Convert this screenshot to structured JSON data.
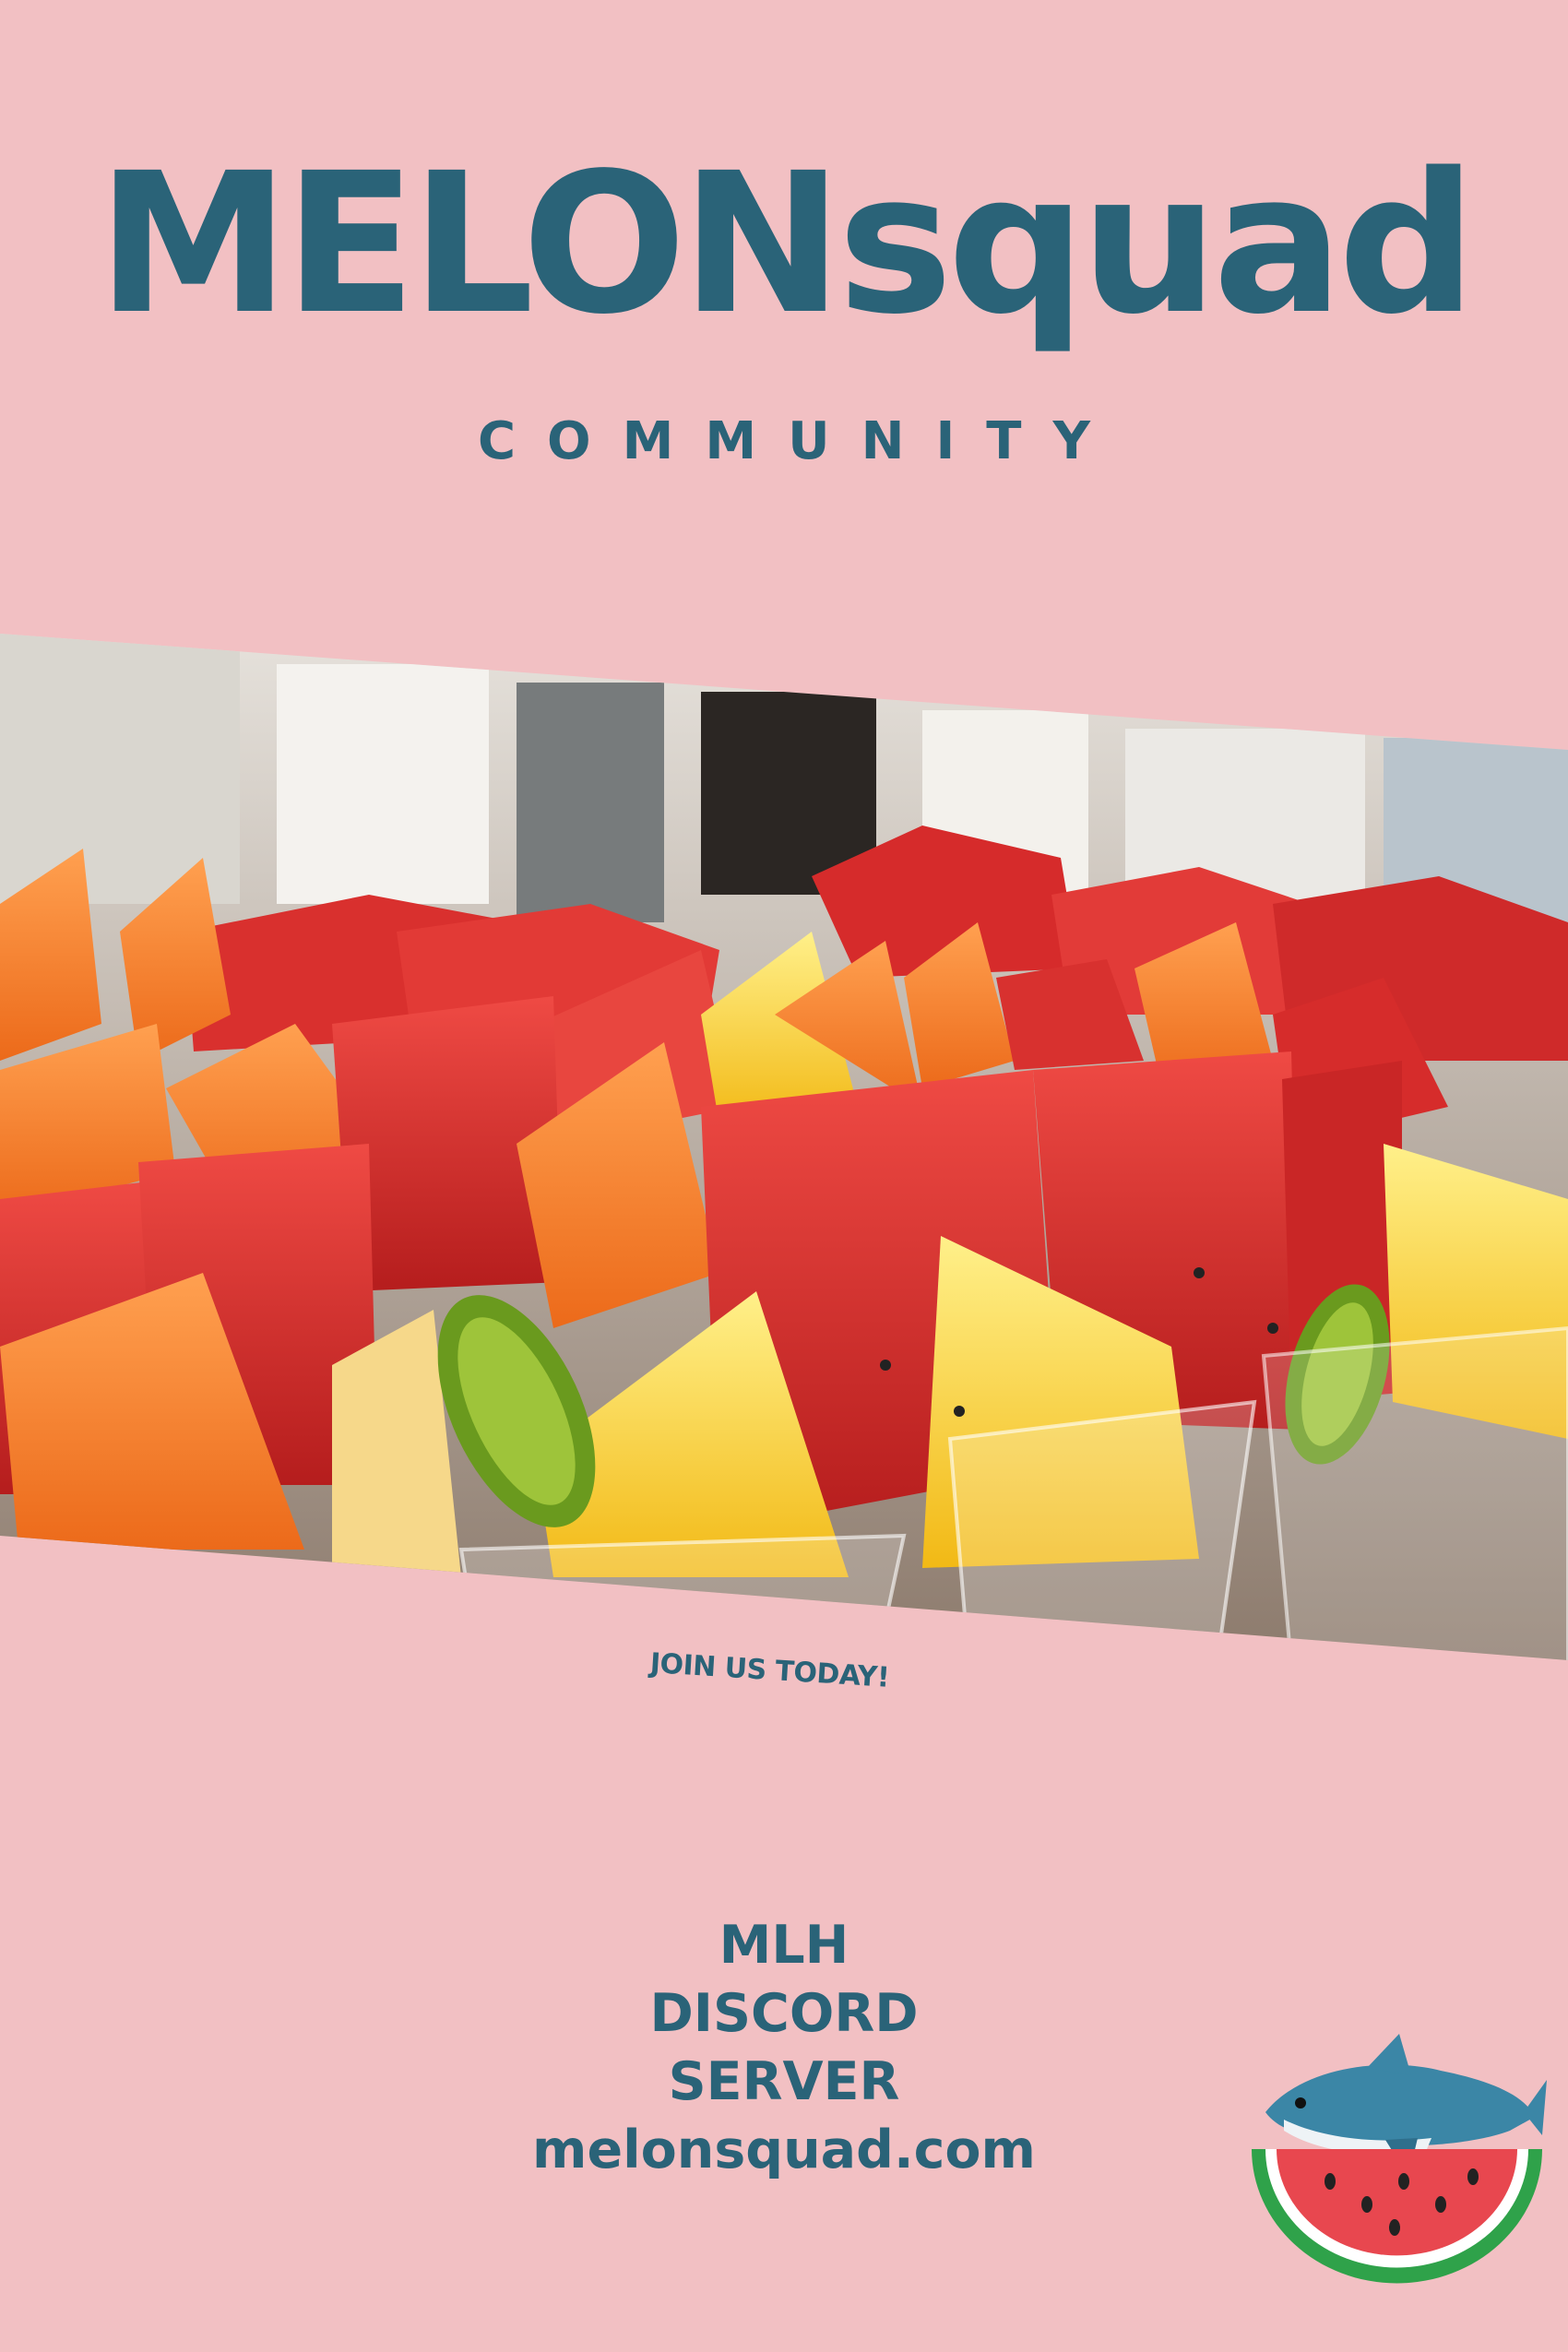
{
  "title": "MELONsquad",
  "subtitle": "COMMUNITY",
  "photo": {
    "subject": "cups of cut watermelon, cantaloupe, pineapple and kiwi"
  },
  "cta": "JOIN US TODAY!",
  "info": {
    "line1": "MLH",
    "line2": "DISCORD",
    "line3": "SERVER",
    "url": "melonsquad.com"
  },
  "mascot": {
    "icon": "shark-on-watermelon-icon"
  },
  "colors": {
    "background": "#f2c0c3",
    "text": "#2a6378",
    "watermelon": "#e8474f",
    "rind": "#2fa24a"
  }
}
